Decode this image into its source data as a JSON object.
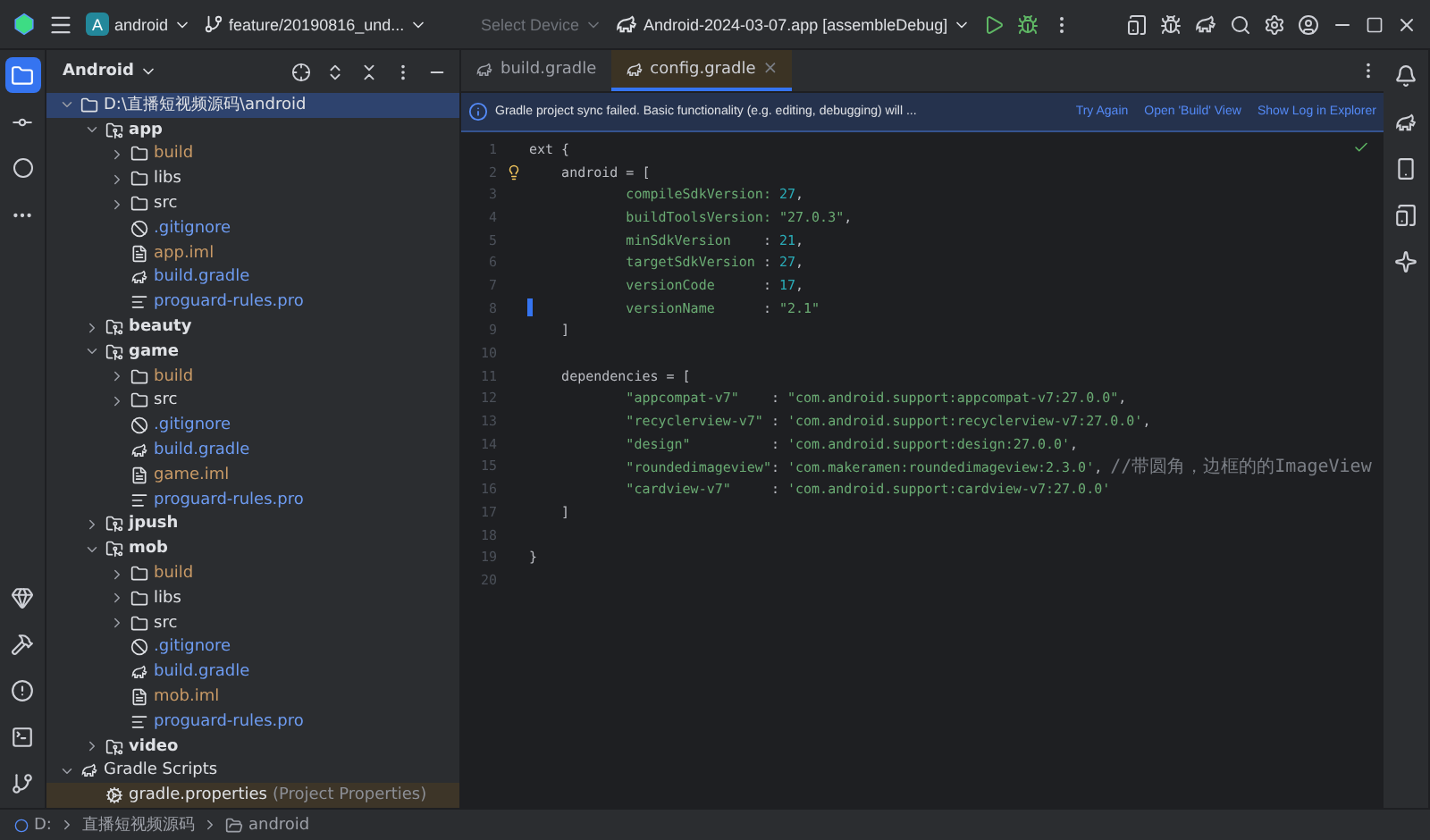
{
  "title_bar": {
    "project": "android",
    "project_badge": "A",
    "branch": "feature/20190816_und...",
    "device": "Select Device",
    "run_config": "Android-2024-03-07.app [assembleDebug]"
  },
  "project_panel": {
    "view": "Android"
  },
  "tree": [
    {
      "label": "D:\\直播短视频源码\\android",
      "kind": "root",
      "expanded": true,
      "selected": true,
      "non_project": false,
      "children": [
        {
          "label": "app",
          "kind": "module",
          "expanded": true,
          "selected": false,
          "non_project": false,
          "color": "#dfe1e5",
          "children": [
            {
              "label": "build",
              "kind": "folder",
              "expanded": false,
              "selected": false,
              "non_project": false,
              "color": "#c99a66"
            },
            {
              "label": "libs",
              "kind": "folder",
              "expanded": false,
              "selected": false,
              "non_project": false,
              "color": "#dfe1e5"
            },
            {
              "label": "src",
              "kind": "folder",
              "expanded": false,
              "selected": false,
              "non_project": false,
              "color": "#dfe1e5"
            },
            {
              "label": ".gitignore",
              "kind": "gitignore",
              "selected": false,
              "non_project": false,
              "color": "#6e9cf2"
            },
            {
              "label": "app.iml",
              "kind": "iml",
              "selected": false,
              "non_project": false,
              "color": "#c99a66"
            },
            {
              "label": "build.gradle",
              "kind": "gradle",
              "selected": false,
              "non_project": false,
              "color": "#6e9cf2"
            },
            {
              "label": "proguard-rules.pro",
              "kind": "text",
              "selected": false,
              "non_project": false,
              "color": "#6e9cf2"
            }
          ]
        },
        {
          "label": "beauty",
          "kind": "module",
          "expanded": false,
          "selected": false,
          "non_project": false,
          "color": "#dfe1e5"
        },
        {
          "label": "game",
          "kind": "module",
          "expanded": true,
          "selected": false,
          "non_project": false,
          "color": "#dfe1e5",
          "children": [
            {
              "label": "build",
              "kind": "folder",
              "expanded": false,
              "selected": false,
              "non_project": false,
              "color": "#c99a66"
            },
            {
              "label": "src",
              "kind": "folder",
              "expanded": false,
              "selected": false,
              "non_project": false,
              "color": "#dfe1e5"
            },
            {
              "label": ".gitignore",
              "kind": "gitignore",
              "selected": false,
              "non_project": false,
              "color": "#6e9cf2"
            },
            {
              "label": "build.gradle",
              "kind": "gradle",
              "selected": false,
              "non_project": false,
              "color": "#6e9cf2"
            },
            {
              "label": "game.iml",
              "kind": "iml",
              "selected": false,
              "non_project": false,
              "color": "#c99a66"
            },
            {
              "label": "proguard-rules.pro",
              "kind": "text",
              "selected": false,
              "non_project": false,
              "color": "#6e9cf2"
            }
          ]
        },
        {
          "label": "jpush",
          "kind": "module",
          "expanded": false,
          "selected": false,
          "non_project": false,
          "color": "#dfe1e5"
        },
        {
          "label": "mob",
          "kind": "module",
          "expanded": true,
          "selected": false,
          "non_project": false,
          "color": "#dfe1e5",
          "children": [
            {
              "label": "build",
              "kind": "folder",
              "expanded": false,
              "selected": false,
              "non_project": false,
              "color": "#c99a66"
            },
            {
              "label": "libs",
              "kind": "folder",
              "expanded": false,
              "selected": false,
              "non_project": false,
              "color": "#dfe1e5"
            },
            {
              "label": "src",
              "kind": "folder",
              "expanded": false,
              "selected": false,
              "non_project": false,
              "color": "#dfe1e5"
            },
            {
              "label": ".gitignore",
              "kind": "gitignore",
              "selected": false,
              "non_project": false,
              "color": "#6e9cf2"
            },
            {
              "label": "build.gradle",
              "kind": "gradle",
              "selected": false,
              "non_project": false,
              "color": "#6e9cf2"
            },
            {
              "label": "mob.iml",
              "kind": "iml",
              "selected": false,
              "non_project": false,
              "color": "#c99a66"
            },
            {
              "label": "proguard-rules.pro",
              "kind": "text",
              "selected": false,
              "non_project": false,
              "color": "#6e9cf2"
            }
          ]
        },
        {
          "label": "video",
          "kind": "module",
          "expanded": false,
          "selected": false,
          "non_project": false,
          "color": "#dfe1e5"
        }
      ]
    },
    {
      "label": "Gradle Scripts",
      "kind": "scripts",
      "expanded": true,
      "selected": false,
      "non_project": false,
      "children": [
        {
          "label": "gradle.properties",
          "note": "(Project Properties)",
          "kind": "properties",
          "selected": false,
          "non_project": true,
          "color": "#dfe1e5"
        }
      ]
    }
  ],
  "tabs": [
    {
      "label": "build.gradle",
      "selected": false
    },
    {
      "label": "config.gradle",
      "selected": true,
      "close": "×"
    }
  ],
  "notification": {
    "message": "Gradle project sync failed. Basic functionality (e.g. editing, debugging) will ...",
    "actions": [
      "Try Again",
      "Open 'Build' View",
      "Show Log in Explorer"
    ]
  },
  "code": [
    {
      "number": "1",
      "parts": [
        {
          "kind": "plain",
          "text": "ext {"
        }
      ]
    },
    {
      "number": "2",
      "bulb": true,
      "parts": [
        {
          "kind": "plain",
          "text": "    android = ["
        }
      ]
    },
    {
      "number": "3",
      "parts": [
        {
          "kind": "string",
          "text": "            compileSdkVersion: "
        },
        {
          "kind": "number",
          "text": "27"
        },
        {
          "kind": "plain",
          "text": ","
        }
      ]
    },
    {
      "number": "4",
      "parts": [
        {
          "kind": "string",
          "text": "            buildToolsVersion: \"27.0.3\""
        },
        {
          "kind": "plain",
          "text": ","
        }
      ]
    },
    {
      "number": "5",
      "parts": [
        {
          "kind": "string",
          "text": "            minSdkVersion    "
        },
        {
          "kind": "plain",
          "text": ": "
        },
        {
          "kind": "number",
          "text": "21"
        },
        {
          "kind": "plain",
          "text": ","
        }
      ]
    },
    {
      "number": "6",
      "parts": [
        {
          "kind": "string",
          "text": "            targetSdkVersion "
        },
        {
          "kind": "plain",
          "text": ": "
        },
        {
          "kind": "number",
          "text": "27"
        },
        {
          "kind": "plain",
          "text": ","
        }
      ]
    },
    {
      "number": "7",
      "parts": [
        {
          "kind": "string",
          "text": "            versionCode      "
        },
        {
          "kind": "plain",
          "text": ": "
        },
        {
          "kind": "number",
          "text": "17"
        },
        {
          "kind": "plain",
          "text": ","
        }
      ]
    },
    {
      "number": "8",
      "changed": true,
      "parts": [
        {
          "kind": "string",
          "text": "            versionName      "
        },
        {
          "kind": "plain",
          "text": ": "
        },
        {
          "kind": "string",
          "text": "\"2.1\""
        }
      ]
    },
    {
      "number": "9",
      "parts": [
        {
          "kind": "plain",
          "text": "    ]"
        }
      ]
    },
    {
      "number": "10"
    },
    {
      "number": "11",
      "parts": [
        {
          "kind": "plain",
          "text": "    dependencies = ["
        }
      ]
    },
    {
      "number": "12",
      "parts": [
        {
          "kind": "string",
          "text": "            \"appcompat-v7\"    "
        },
        {
          "kind": "plain",
          "text": ": "
        },
        {
          "kind": "string",
          "text": "\"com.android.support:appcompat-v7:27.0.0\""
        },
        {
          "kind": "plain",
          "text": ","
        }
      ]
    },
    {
      "number": "13",
      "parts": [
        {
          "kind": "string",
          "text": "            \"recyclerview-v7\" "
        },
        {
          "kind": "plain",
          "text": ": "
        },
        {
          "kind": "string",
          "text": "'com.android.support:recyclerview-v7:27.0.0'"
        },
        {
          "kind": "plain",
          "text": ","
        }
      ]
    },
    {
      "number": "14",
      "parts": [
        {
          "kind": "string",
          "text": "            \"design\"          "
        },
        {
          "kind": "plain",
          "text": ": "
        },
        {
          "kind": "string",
          "text": "'com.android.support:design:27.0.0'"
        },
        {
          "kind": "plain",
          "text": ","
        }
      ]
    },
    {
      "number": "15",
      "parts": [
        {
          "kind": "string",
          "text": "            \"roundedimageview\""
        },
        {
          "kind": "plain",
          "text": ": "
        },
        {
          "kind": "string",
          "text": "'com.makeramen:roundedimageview:2.3.0'"
        },
        {
          "kind": "plain",
          "text": ", "
        },
        {
          "kind": "comment",
          "text": "//带圆角，边框的的ImageView"
        }
      ]
    },
    {
      "number": "16",
      "parts": [
        {
          "kind": "string",
          "text": "            \"cardview-v7\"     "
        },
        {
          "kind": "plain",
          "text": ": "
        },
        {
          "kind": "string",
          "text": "'com.android.support:cardview-v7:27.0.0'"
        }
      ]
    },
    {
      "number": "17",
      "parts": [
        {
          "kind": "plain",
          "text": "    ]"
        }
      ]
    },
    {
      "number": "18"
    },
    {
      "number": "19",
      "parts": [
        {
          "kind": "plain",
          "text": "}"
        }
      ]
    },
    {
      "number": "20"
    }
  ],
  "breadcrumb": [
    "D:",
    "直播短视频源码",
    "android"
  ]
}
